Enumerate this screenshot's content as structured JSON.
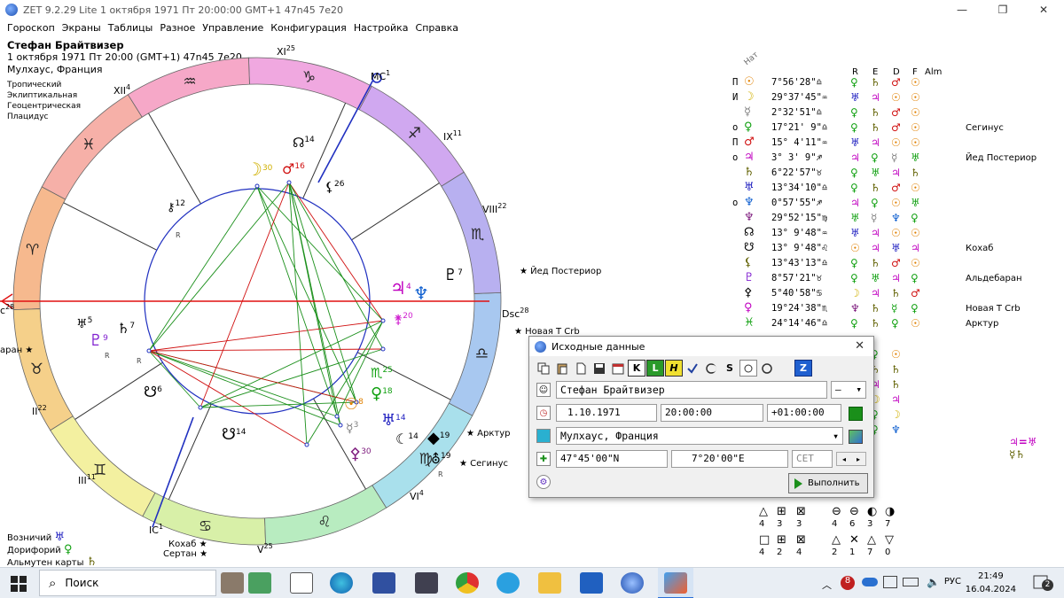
{
  "window": {
    "title": "ZET 9.2.29 Lite    1 октября 1971  Пт  20:00:00 GMT+1 47n45  7e20",
    "minimize": "—",
    "maximize": "❐",
    "close": "✕"
  },
  "menu": [
    "Гороскоп",
    "Экраны",
    "Таблицы",
    "Разное",
    "Управление",
    "Конфигурация",
    "Настройка",
    "Справка"
  ],
  "chart_info": {
    "name": "Стефан Брайтвизер",
    "datetime": "1 октября 1971  Пт  20:00 (GMT+1) 47n45  7e20",
    "place": "Мулхаус, Франция",
    "modes": [
      "Тропический",
      "Эклиптикальная",
      "Геоцентрическая",
      "Плацидус"
    ]
  },
  "wheel": {
    "house_labels": [
      {
        "label": "XI",
        "deg": "25"
      },
      {
        "label": "MC",
        "deg": "1"
      },
      {
        "label": "IX",
        "deg": "11"
      },
      {
        "label": "VIII",
        "deg": "22"
      },
      {
        "label": "Dsc",
        "deg": "28"
      },
      {
        "label": "VI",
        "deg": "4"
      },
      {
        "label": "V",
        "deg": "25"
      },
      {
        "label": "IC",
        "deg": "1"
      },
      {
        "label": "III",
        "deg": "11"
      },
      {
        "label": "II",
        "deg": "22"
      },
      {
        "label": "c",
        "deg": "28"
      },
      {
        "label": "XII",
        "deg": "4"
      }
    ],
    "zodiac_signs": [
      "♈",
      "♉",
      "♊",
      "♋",
      "♌",
      "♍",
      "♎",
      "♏",
      "♐",
      "♑",
      "♒",
      "♓"
    ],
    "planets": [
      {
        "glyph": "☊",
        "deg": "14",
        "color": "#000000"
      },
      {
        "glyph": "♂",
        "deg": "16",
        "color": "#d01010"
      },
      {
        "glyph": "☽",
        "deg": "30",
        "color": "#d0b000"
      },
      {
        "glyph": "⚸",
        "deg": "26",
        "color": "#000000"
      },
      {
        "glyph": "⚷",
        "deg": "12",
        "color": "#000000"
      },
      {
        "glyph": "♃",
        "deg": "4",
        "color": "#c000c0"
      },
      {
        "glyph": "♆",
        "deg": "",
        "color": "#1060d0"
      },
      {
        "glyph": "♇",
        "deg": "7",
        "color": "#000000"
      },
      {
        "glyph": "⚵",
        "deg": "20",
        "color": "#d020d0"
      },
      {
        "glyph": "♅",
        "deg": "5",
        "color": "#000000"
      },
      {
        "glyph": "♇",
        "deg": "9",
        "color": "#8020d0"
      },
      {
        "glyph": "♄",
        "deg": "7",
        "color": "#000000"
      },
      {
        "glyph": "☋",
        "deg": "6",
        "color": "#000000"
      },
      {
        "glyph": "☉",
        "deg": "8",
        "color": "#e08000"
      },
      {
        "glyph": "♀",
        "deg": "18",
        "color": "#10a010"
      },
      {
        "glyph": "♏",
        "deg": "25",
        "color": "#10a010"
      },
      {
        "glyph": "♅",
        "deg": "14",
        "color": "#2020c0"
      },
      {
        "glyph": "☾",
        "deg": "14",
        "color": "#000000"
      },
      {
        "glyph": "◆",
        "deg": "19",
        "color": "#000000"
      },
      {
        "glyph": "☿",
        "deg": "3",
        "color": "#808080"
      },
      {
        "glyph": "⚴",
        "deg": "30",
        "color": "#802080"
      },
      {
        "glyph": "⛢",
        "deg": "19",
        "color": "#000000"
      },
      {
        "glyph": "☋",
        "deg": "14",
        "color": "#000000"
      }
    ],
    "retro_label": "R",
    "star_labels": [
      "Йед Постериор",
      "Новая Т Crb",
      "Арктур",
      "Сегинус",
      "Кохаб",
      "Сертан",
      "аран"
    ]
  },
  "positions": {
    "header": {
      "nat": "Нат",
      "r": "R",
      "e": "E",
      "d": "D",
      "f": "F",
      "alm": "Alm"
    },
    "rows": [
      {
        "flag": "П",
        "planet": "☉",
        "pcolor": "#e08000",
        "pos": "7°56'28\"♎",
        "r": "♀",
        "rc": "#10a010",
        "e": "♄",
        "ec": "#606000",
        "d": "♂",
        "dc": "#d01010",
        "f": "☉",
        "fc": "#e08000",
        "star": ""
      },
      {
        "flag": "И",
        "planet": "☽",
        "pcolor": "#d0b000",
        "pos": "29°37'45\"♒",
        "r": "♅",
        "rc": "#2020c0",
        "e": "♃",
        "ec": "#c000c0",
        "d": "☉",
        "dc": "#e08000",
        "f": "☉",
        "fc": "#e08000",
        "star": ""
      },
      {
        "flag": "",
        "planet": "☿",
        "pcolor": "#808080",
        "pos": "2°32'51\"♎",
        "r": "♀",
        "rc": "#10a010",
        "e": "♄",
        "ec": "#606000",
        "d": "♂",
        "dc": "#d01010",
        "f": "☉",
        "fc": "#e08000",
        "star": ""
      },
      {
        "flag": "о",
        "planet": "♀",
        "pcolor": "#10a010",
        "pos": "17°21' 9\"♎",
        "r": "♀",
        "rc": "#10a010",
        "e": "♄",
        "ec": "#606000",
        "d": "♂",
        "dc": "#d01010",
        "f": "☉",
        "fc": "#e08000",
        "star": "Сегинус"
      },
      {
        "flag": "П",
        "planet": "♂",
        "pcolor": "#d01010",
        "pos": "15° 4'11\"♒",
        "r": "♅",
        "rc": "#2020c0",
        "e": "♃",
        "ec": "#c000c0",
        "d": "☉",
        "dc": "#e08000",
        "f": "☉",
        "fc": "#e08000",
        "star": ""
      },
      {
        "flag": "о",
        "planet": "♃",
        "pcolor": "#c000c0",
        "pos": "3° 3' 9\"♐",
        "r": "♃",
        "rc": "#c000c0",
        "e": "♀",
        "ec": "#10a010",
        "d": "☿",
        "dc": "#808080",
        "f": "♅",
        "fc": "#10a010",
        "star": "Йед Постериор"
      },
      {
        "flag": "",
        "planet": "♄",
        "pcolor": "#606000",
        "pos": "6°22'57\"♉",
        "r": "♀",
        "rc": "#10a010",
        "e": "♅",
        "ec": "#10a010",
        "d": "♃",
        "dc": "#c000c0",
        "f": "♄",
        "fc": "#606000",
        "star": ""
      },
      {
        "flag": "",
        "planet": "♅",
        "pcolor": "#2020c0",
        "pos": "13°34'10\"♎",
        "r": "♀",
        "rc": "#10a010",
        "e": "♄",
        "ec": "#606000",
        "d": "♂",
        "dc": "#d01010",
        "f": "☉",
        "fc": "#e08000",
        "star": ""
      },
      {
        "flag": "о",
        "planet": "♆",
        "pcolor": "#1060d0",
        "pos": "0°57'55\"♐",
        "r": "♃",
        "rc": "#c000c0",
        "e": "♀",
        "ec": "#10a010",
        "d": "☉",
        "dc": "#e08000",
        "f": "♅",
        "fc": "#10a010",
        "star": ""
      },
      {
        "flag": "",
        "planet": "♆",
        "pcolor": "#802080",
        "pos": "29°52'15\"♍",
        "r": "♅",
        "rc": "#10a010",
        "e": "☿",
        "ec": "#808080",
        "d": "♆",
        "dc": "#1060d0",
        "f": "♀",
        "fc": "#10a010",
        "star": ""
      },
      {
        "flag": "",
        "planet": "☊",
        "pcolor": "#000000",
        "pos": "13° 9'48\"♒",
        "r": "♅",
        "rc": "#2020c0",
        "e": "♃",
        "ec": "#c000c0",
        "d": "☉",
        "dc": "#e08000",
        "f": "☉",
        "fc": "#e08000",
        "star": ""
      },
      {
        "flag": "",
        "planet": "☋",
        "pcolor": "#000000",
        "pos": "13° 9'48\"♌",
        "r": "☉",
        "rc": "#e08000",
        "e": "♃",
        "ec": "#c000c0",
        "d": "♅",
        "dc": "#2020c0",
        "f": "♃",
        "fc": "#c000c0",
        "star": "Кохаб"
      },
      {
        "flag": "",
        "planet": "⚸",
        "pcolor": "#606000",
        "pos": "13°43'13\"♎",
        "r": "♀",
        "rc": "#10a010",
        "e": "♄",
        "ec": "#606000",
        "d": "♂",
        "dc": "#d01010",
        "f": "☉",
        "fc": "#e08000",
        "star": ""
      },
      {
        "flag": "",
        "planet": "♇",
        "pcolor": "#8020d0",
        "pos": "8°57'21\"♉",
        "r": "♀",
        "rc": "#10a010",
        "e": "♅",
        "ec": "#10a010",
        "d": "♃",
        "dc": "#c000c0",
        "f": "♀",
        "fc": "#10a010",
        "star": "Альдебаран"
      },
      {
        "flag": "",
        "planet": "⚴",
        "pcolor": "#000000",
        "pos": "5°40'58\"♋",
        "r": "☽",
        "rc": "#d0b000",
        "e": "♃",
        "ec": "#c000c0",
        "d": "♄",
        "dc": "#606000",
        "f": "♂",
        "fc": "#d01010",
        "star": ""
      },
      {
        "flag": "",
        "planet": "♀",
        "pcolor": "#c000c0",
        "pos": "19°24'38\"♏",
        "r": "♆",
        "rc": "#802080",
        "e": "♄",
        "ec": "#606000",
        "d": "☿",
        "dc": "#10a010",
        "f": "♀",
        "fc": "#10a010",
        "star": "Новая Т Crb"
      },
      {
        "flag": "",
        "planet": "♓",
        "pcolor": "#10a010",
        "pos": "24°14'46\"♎",
        "r": "♀",
        "rc": "#10a010",
        "e": "♄",
        "ec": "#606000",
        "d": "♀",
        "dc": "#10a010",
        "f": "☉",
        "fc": "#e08000",
        "star": "Арктур"
      }
    ],
    "dim_tail": [
      {
        "r": "♄",
        "rc": "#606000",
        "e": "♀",
        "ec": "#10a010",
        "d": "☉",
        "dc": "#e08000"
      },
      {
        "r": "♄",
        "rc": "#606000",
        "e": "♄",
        "ec": "#606000",
        "d": "♄",
        "dc": "#606000"
      },
      {
        "r": "♅",
        "rc": "#10a010",
        "e": "♃",
        "ec": "#c000c0",
        "d": "♄",
        "dc": "#606000"
      },
      {
        "r": "♀",
        "rc": "#10a010",
        "e": "☽",
        "ec": "#d0b000",
        "d": "♃",
        "dc": "#c000c0"
      },
      {
        "r": "♂",
        "rc": "#d01010",
        "e": "♀",
        "ec": "#10a010",
        "d": "☽",
        "dc": "#d0b000"
      },
      {
        "r": "♄",
        "rc": "#606000",
        "e": "♀",
        "ec": "#10a010",
        "d": "♆",
        "dc": "#1060d0"
      }
    ],
    "right_glyphs": [
      "♃=♅",
      "☿♄"
    ]
  },
  "dialog": {
    "title": "Исходные данные",
    "close": "✕",
    "toolbar_text": [
      "K",
      "L",
      "H",
      "Z"
    ],
    "name_value": "Стефан Брайтвизер",
    "gender_value": "—",
    "date_value": "1.10.1971",
    "time_value": "20:00:00",
    "tz_value": "+01:00:00",
    "place_value": "Мулхаус, Франция",
    "lat_value": "47°45'00\"N",
    "lon_value": "7°20'00\"E",
    "zone_value": "CET",
    "run_label": "Выполнить"
  },
  "aspect_grid": {
    "row1_glyphs": [
      "△",
      "⊞",
      "⊠",
      "⊖",
      "⊖",
      "◐",
      "◑"
    ],
    "row1_nums": [
      "4",
      "3",
      "3",
      "4",
      "6",
      "3",
      "7"
    ],
    "row2_glyphs": [
      "□",
      "⊞",
      "⊠",
      "△",
      "✕",
      "△",
      "▽"
    ],
    "row2_nums": [
      "4",
      "2",
      "4",
      "2",
      "1",
      "7",
      "0"
    ]
  },
  "bottom_left": [
    {
      "label": "Возничий",
      "glyph": "♅",
      "color": "#2020c0"
    },
    {
      "label": "Дорифорий",
      "glyph": "♀",
      "color": "#10a010"
    },
    {
      "label": "Альмутен карты",
      "glyph": "♄",
      "color": "#606000"
    }
  ],
  "taskbar": {
    "search_placeholder": "Поиск",
    "lang": "РУС",
    "time": "21:49",
    "date": "16.04.2024",
    "notif_count": "2"
  }
}
